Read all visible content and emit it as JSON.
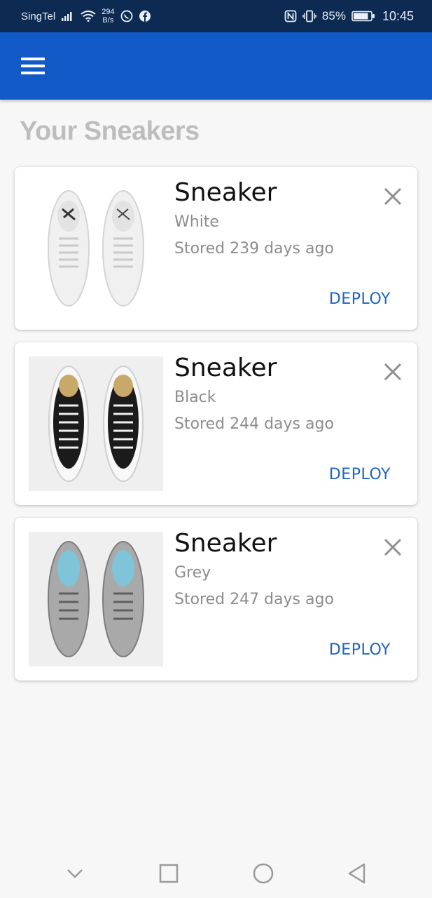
{
  "status_bar": {
    "carrier": "SingTel",
    "speed_value": "294",
    "speed_unit": "B/s",
    "battery": "85%",
    "time": "10:45"
  },
  "app_bar": {
    "menu_icon": "hamburger-menu-icon",
    "color": "#1159c6"
  },
  "page": {
    "title": "Your Sneakers"
  },
  "sneakers": [
    {
      "name": "Sneaker",
      "color": "White",
      "stored": "Stored 239 days ago",
      "action": "DEPLOY",
      "shoe_color": "#f2f2f2"
    },
    {
      "name": "Sneaker",
      "color": "Black",
      "stored": "Stored 244 days ago",
      "action": "DEPLOY",
      "shoe_color": "#1b1b1b"
    },
    {
      "name": "Sneaker",
      "color": "Grey",
      "stored": "Stored 247 days ago",
      "action": "DEPLOY",
      "shoe_color": "#a9a9a9"
    }
  ],
  "nav_bar": {
    "icons": [
      "chevron-down-icon",
      "recents-square-icon",
      "home-circle-icon",
      "back-triangle-icon"
    ]
  },
  "colors": {
    "status_bar": "#0c2a52",
    "accent": "#1c64c4",
    "title_grey": "#bdbdbd"
  }
}
